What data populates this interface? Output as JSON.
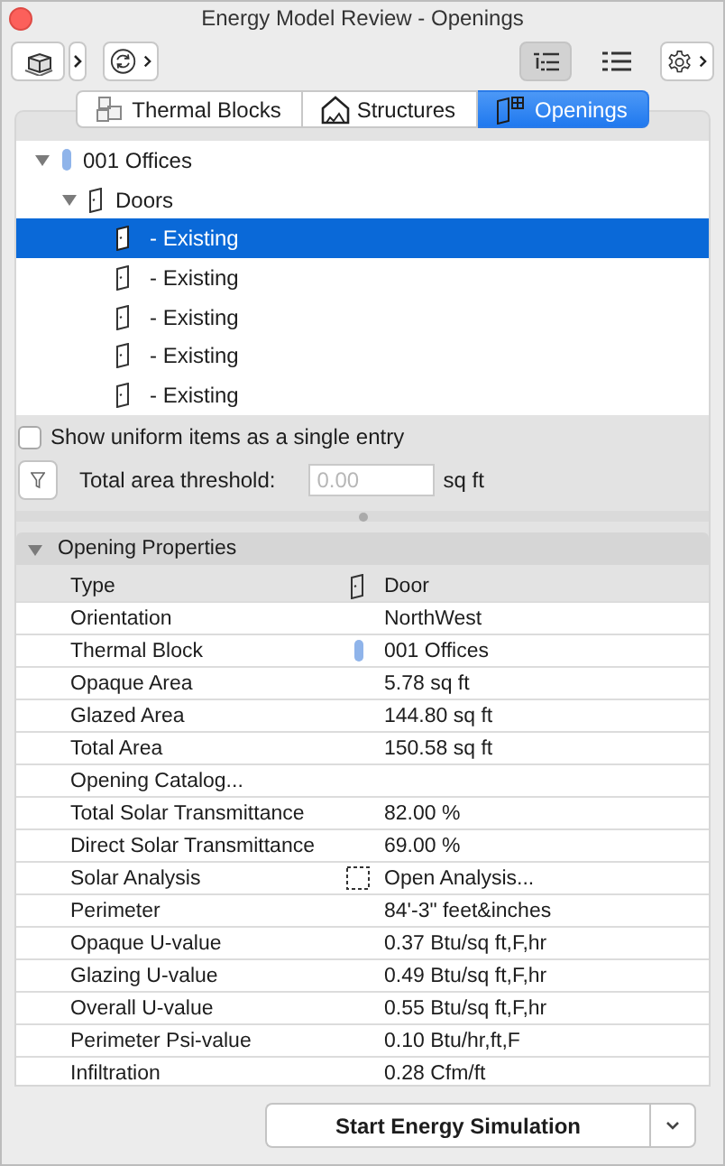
{
  "window": {
    "title": "Energy Model Review - Openings"
  },
  "view_modes": [
    {
      "selected": true
    },
    {
      "selected": false
    }
  ],
  "tabs": [
    {
      "label": "Thermal Blocks",
      "kind": "blocks",
      "selected": false
    },
    {
      "label": "Structures",
      "kind": "structures",
      "selected": false
    },
    {
      "label": "Openings",
      "kind": "openings",
      "selected": true
    }
  ],
  "tree": [
    {
      "label": "001 Offices",
      "kind": "block",
      "expanded": true,
      "selected": false,
      "children": [
        {
          "label": "Doors",
          "kind": "group",
          "expanded": true,
          "selected": false,
          "children": [
            {
              "label": "- Existing",
              "kind": "door",
              "selected": true
            },
            {
              "label": "- Existing",
              "kind": "door",
              "selected": false
            },
            {
              "label": "- Existing",
              "kind": "door",
              "selected": false
            },
            {
              "label": "- Existing",
              "kind": "door",
              "selected": false
            },
            {
              "label": "- Existing",
              "kind": "door",
              "selected": false
            }
          ]
        }
      ]
    }
  ],
  "uniform_option": {
    "label": "Show uniform items as a single entry",
    "checked": false
  },
  "threshold": {
    "label": "Total area threshold:",
    "placeholder": "0.00",
    "unit": "sq ft"
  },
  "properties": {
    "title": "Opening Properties",
    "expanded": true,
    "rows": [
      {
        "name": "Type",
        "value": "Door",
        "kind": "type"
      },
      {
        "name": "Orientation",
        "value": "NorthWest",
        "kind": "plain"
      },
      {
        "name": "Thermal Block",
        "value": "001 Offices",
        "kind": "block"
      },
      {
        "name": "Opaque Area",
        "value": "5.78 sq ft",
        "kind": "plain"
      },
      {
        "name": "Glazed Area",
        "value": "144.80 sq ft",
        "kind": "plain"
      },
      {
        "name": "Total Area",
        "value": "150.58 sq ft",
        "kind": "plain"
      },
      {
        "name": "Opening Catalog...",
        "kind": "link"
      },
      {
        "name": "Total Solar Transmittance",
        "value": "82.00 %",
        "kind": "plain"
      },
      {
        "name": "Direct Solar Transmittance",
        "value": "69.00 %",
        "kind": "plain"
      },
      {
        "name": "Solar Analysis",
        "value": "Open Analysis...",
        "kind": "analysis"
      },
      {
        "name": "Perimeter",
        "value": "84'-3\" feet&inches",
        "kind": "plain"
      },
      {
        "name": "Opaque U-value",
        "value": "0.37 Btu/sq ft,F,hr",
        "kind": "plain"
      },
      {
        "name": "Glazing U-value",
        "value": "0.49 Btu/sq ft,F,hr",
        "kind": "plain"
      },
      {
        "name": "Overall U-value",
        "value": "0.55 Btu/sq ft,F,hr",
        "kind": "plain"
      },
      {
        "name": "Perimeter Psi-value",
        "value": "0.10 Btu/hr,ft,F",
        "kind": "plain"
      },
      {
        "name": "Infiltration",
        "value": "0.28 Cfm/ft",
        "kind": "plain"
      }
    ]
  },
  "footer": {
    "button": "Start Energy Simulation"
  }
}
